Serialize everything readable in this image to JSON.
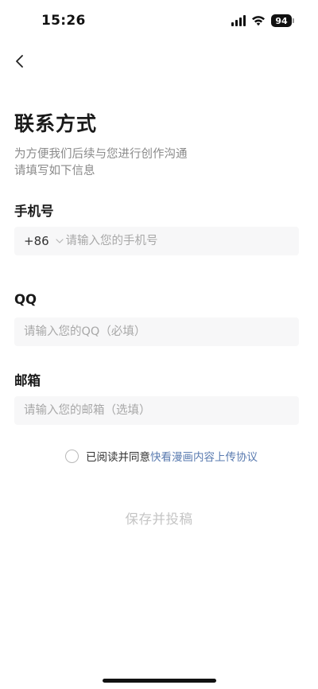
{
  "status_bar": {
    "time": "15:26",
    "battery": "94",
    "icons": [
      "signal-icon",
      "wifi-icon",
      "battery-icon"
    ]
  },
  "nav": {
    "back_icon": "chevron-left-icon"
  },
  "header": {
    "title": "联系方式",
    "description_lines": [
      "为方便我们后续与您进行创作沟通",
      "请填写如下信息"
    ]
  },
  "form": {
    "phone": {
      "label": "手机号",
      "country_code": "+86",
      "placeholder": "请输入您的手机号",
      "value": ""
    },
    "qq": {
      "label": "QQ",
      "placeholder": "请输入您的QQ（必填）",
      "value": ""
    },
    "email": {
      "label": "邮箱",
      "placeholder": "请输入您的邮箱（选填）",
      "value": ""
    }
  },
  "agreement": {
    "checked": false,
    "text": "已阅读并同意",
    "link_text": "快看漫画内容上传协议"
  },
  "submit": {
    "label": "保存并投稿"
  },
  "colors": {
    "link": "#5a7bb0",
    "disabled_text": "#c4c4c4",
    "placeholder": "#a8a8a8",
    "input_bg": "#f7f7f8"
  }
}
